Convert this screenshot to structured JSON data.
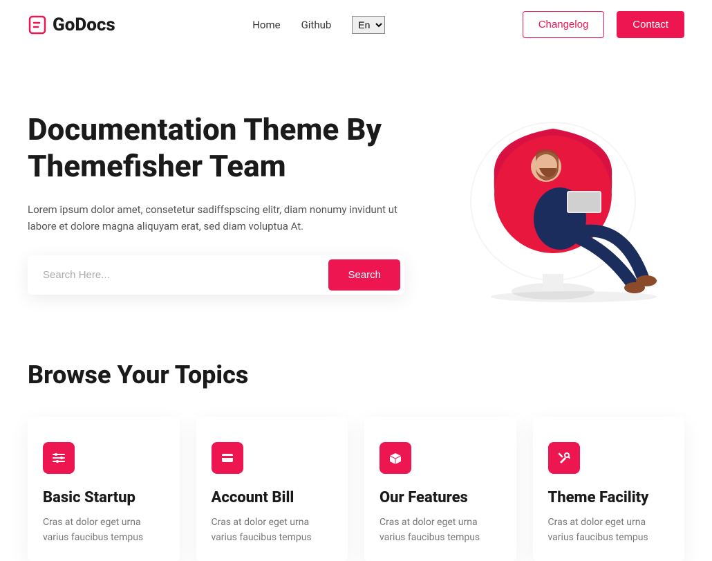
{
  "brand": "GoDocs",
  "nav": {
    "home": "Home",
    "github": "Github",
    "lang": "En"
  },
  "header": {
    "changelog": "Changelog",
    "contact": "Contact"
  },
  "hero": {
    "title": "Documentation Theme By Themefisher Team",
    "desc": "Lorem ipsum dolor amet, consetetur sadiffspscing elitr, diam nonumy invidunt ut labore et dolore magna aliquyam erat, sed diam voluptua At.",
    "search_placeholder": "Search Here...",
    "search_btn": "Search"
  },
  "topics": {
    "heading": "Browse Your Topics",
    "items": [
      {
        "title": "Basic Startup",
        "desc": "Cras at dolor eget urna varius faucibus tempus"
      },
      {
        "title": "Account Bill",
        "desc": "Cras at dolor eget urna varius faucibus tempus"
      },
      {
        "title": "Our Features",
        "desc": "Cras at dolor eget urna varius faucibus tempus"
      },
      {
        "title": "Theme Facility",
        "desc": "Cras at dolor eget urna varius faucibus tempus"
      }
    ]
  }
}
